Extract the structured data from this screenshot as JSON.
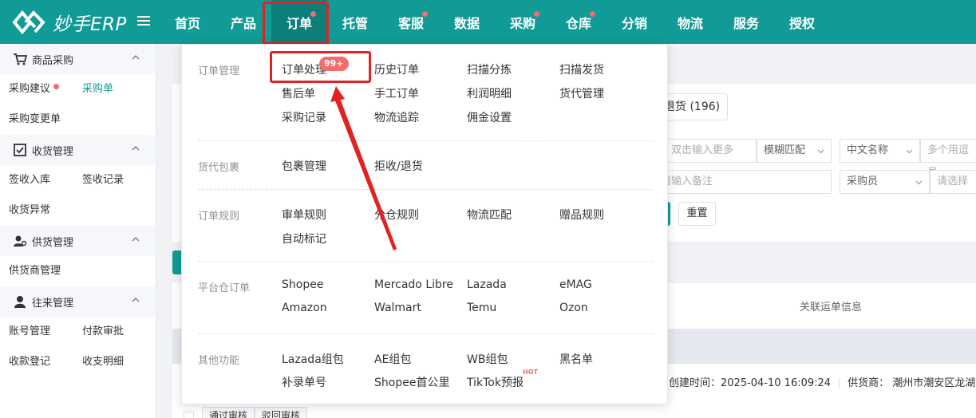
{
  "app": {
    "logo_text": "妙手ERP"
  },
  "nav": {
    "items": [
      {
        "label": "首页",
        "dot": false
      },
      {
        "label": "产品",
        "dot": false
      },
      {
        "label": "订单",
        "dot": true,
        "active": true
      },
      {
        "label": "托管",
        "dot": false
      },
      {
        "label": "客服",
        "dot": true
      },
      {
        "label": "数据",
        "dot": false
      },
      {
        "label": "采购",
        "dot": true
      },
      {
        "label": "仓库",
        "dot": true
      },
      {
        "label": "分销",
        "dot": false
      },
      {
        "label": "物流",
        "dot": false
      },
      {
        "label": "服务",
        "dot": false
      },
      {
        "label": "授权",
        "dot": false
      }
    ]
  },
  "sidebar": {
    "groups": [
      {
        "title": "商品采购",
        "icon": "cart-icon",
        "links": [
          {
            "label": "采购建议",
            "dot": true
          },
          {
            "label": "采购单",
            "current": true
          },
          {
            "label": "采购变更单"
          }
        ]
      },
      {
        "title": "收货管理",
        "icon": "checkbox-icon",
        "links": [
          {
            "label": "签收入库"
          },
          {
            "label": "签收记录"
          },
          {
            "label": "收货异常"
          }
        ]
      },
      {
        "title": "供货管理",
        "icon": "supplier-icon",
        "links": [
          {
            "label": "供货商管理"
          }
        ]
      },
      {
        "title": "往来管理",
        "icon": "user-icon",
        "links": [
          {
            "label": "账号管理"
          },
          {
            "label": "付款审批"
          },
          {
            "label": "收款登记"
          },
          {
            "label": "收支明细"
          }
        ]
      }
    ]
  },
  "background": {
    "tab_label": "退货 (196)",
    "fields": {
      "search_placeholder": "，双击输入更多",
      "match_mode": "模糊匹配",
      "name_type": "中文名称",
      "multi_placeholder": "多个用逗号",
      "remark_placeholder": "请输入备注",
      "buyer_label": "采购员",
      "select_placeholder": "请选择"
    },
    "reset_label": "重置",
    "column_header": "关联运单信息",
    "created_label": "创建时间：2025-04-10 16:09:24",
    "supplier_label": "供货商：  潮州市潮安区龙湖镇",
    "bottom_buttons": [
      "通过审核",
      "驳回审核"
    ]
  },
  "mega_menu": {
    "sections": [
      {
        "title": "订单管理",
        "links": [
          "订单处理",
          "历史订单",
          "扫描分拣",
          "扫描发货",
          "售后单",
          "手工订单",
          "利润明细",
          "货代管理",
          "采购记录",
          "物流追踪",
          "佣金设置"
        ]
      },
      {
        "title": "货代包裹",
        "links": [
          "包裹管理",
          "拒收/退货"
        ]
      },
      {
        "title": "订单规则",
        "links": [
          "审单规则",
          "分仓规则",
          "物流匹配",
          "赠品规则",
          "自动标记"
        ]
      },
      {
        "title": "平台仓订单",
        "links": [
          "Shopee",
          "Mercado Libre",
          "Lazada",
          "eMAG",
          "Amazon",
          "Walmart",
          "Temu",
          "Ozon"
        ]
      },
      {
        "title": "其他功能",
        "links": [
          "Lazada组包",
          "AE组包",
          "WB组包",
          "黑名单",
          "补录单号",
          "Shopee首公里",
          "TikTok预报"
        ]
      }
    ],
    "badge": "99+",
    "hot_tag": "HOT"
  },
  "colors": {
    "brand_teal": "#119b96",
    "highlight_red": "#e02222",
    "badge_red": "#f56c6c"
  }
}
